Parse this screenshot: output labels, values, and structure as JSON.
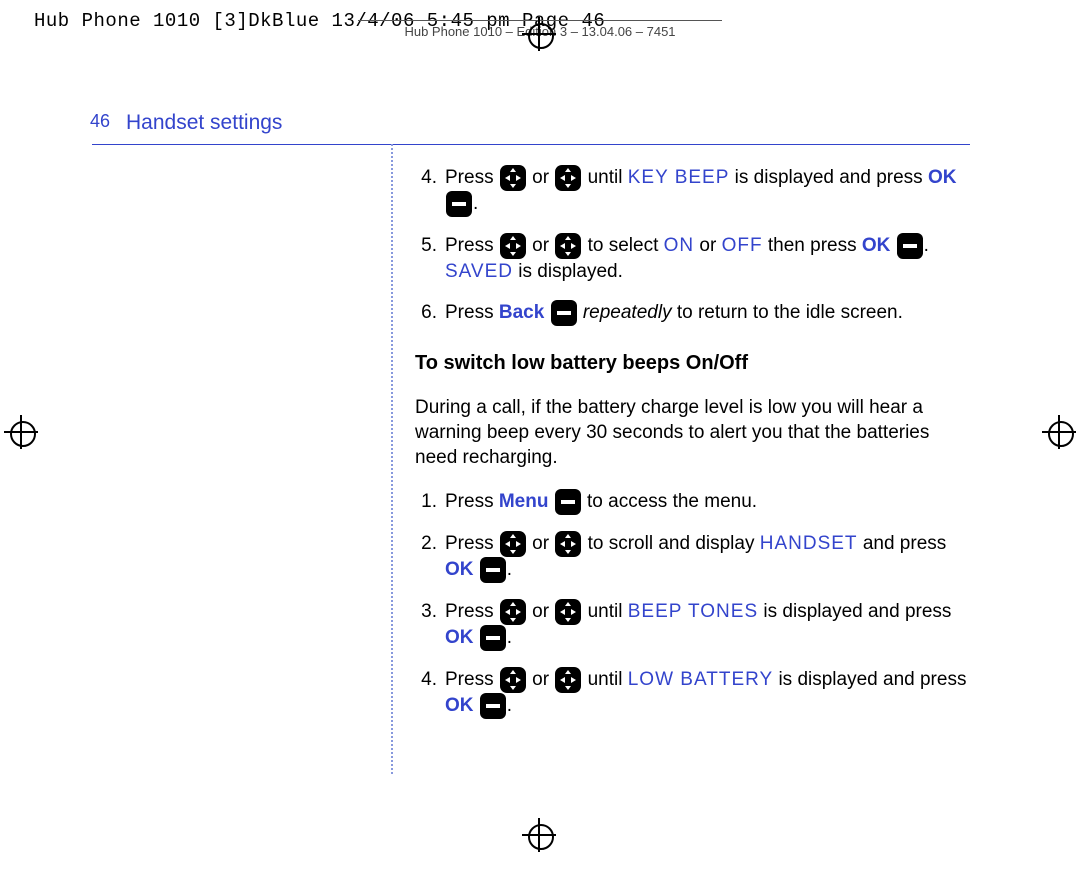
{
  "jobline": "Hub Phone 1010 [3]DkBlue  13/4/06  5:45 pm  Page 46",
  "jobline2": "Hub Phone 1010 – Edition 3 – 13.04.06 – 7451",
  "header": {
    "page_number": "46",
    "section_title": "Handset settings"
  },
  "continued_steps": [
    {
      "num": "4.",
      "txt_pre": "Press ",
      "txt_or": " or ",
      "txt_until": "until ",
      "lcd": "KEY BEEP",
      "txt_after_lcd": " is displayed and press ",
      "soft_label": "OK",
      "txt_end": "."
    },
    {
      "num": "5.",
      "txt_pre": "Press ",
      "txt_or": " or ",
      "txt_select": "to select ",
      "lcd_on": "ON",
      "txt_or2": " or ",
      "lcd_off": "OFF",
      "txt_then": " then press ",
      "soft_label": "OK",
      "txt_end": ". ",
      "lcd_saved": "SAVED",
      "txt_saved_tail": " is displayed."
    },
    {
      "num": "6.",
      "txt_pre": "Press ",
      "soft_label": "Back",
      "txt_rep": " repeatedly",
      "txt_tail": " to return to the idle screen."
    }
  ],
  "subhead": "To switch low battery beeps On/Off",
  "subhead_intro": "During a call, if the battery charge level is low you will hear a warning beep every 30 seconds to alert you that the batteries need recharging.",
  "low_batt_steps": [
    {
      "num": "1.",
      "txt_pre": "Press ",
      "soft_label": "Menu",
      "txt_tail": " to access the menu."
    },
    {
      "num": "2.",
      "txt_pre": "Press ",
      "txt_or": " or ",
      "txt_scroll": "to scroll and display ",
      "lcd": "HANDSET",
      "txt_andpress": " and press ",
      "soft_label": "OK",
      "txt_end": "."
    },
    {
      "num": "3.",
      "txt_pre": "Press ",
      "txt_or": " or ",
      "txt_until": "until ",
      "lcd": "BEEP TONES",
      "txt_after_lcd": " is displayed and press ",
      "soft_label": "OK",
      "txt_end": "."
    },
    {
      "num": "4.",
      "txt_pre": "Press ",
      "txt_or": " or ",
      "txt_until": "until ",
      "lcd": "LOW BATTERY",
      "txt_after_lcd": " is displayed and press ",
      "soft_label": "OK",
      "txt_end": "."
    }
  ]
}
